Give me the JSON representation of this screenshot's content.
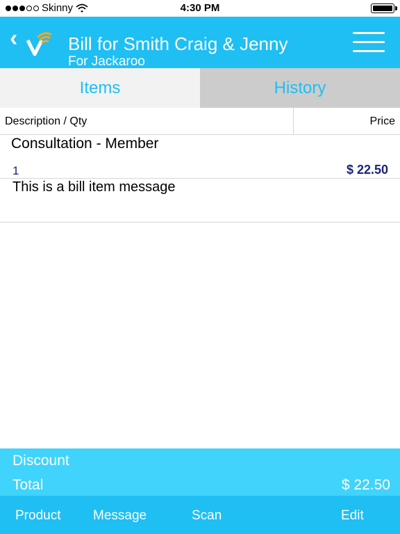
{
  "status_bar": {
    "carrier": "Skinny",
    "time": "4:30 PM",
    "signal_icon": "signal-dots-icon",
    "wifi_icon": "wifi-icon",
    "battery_icon": "battery-icon"
  },
  "header": {
    "title": "Bill for Smith Craig & Jenny",
    "subtitle": "For Jackaroo",
    "back_icon": "chevron-left-icon",
    "logo_icon": "logo-icon",
    "menu_icon": "hamburger-menu-icon",
    "background": "#1fbef3"
  },
  "tabs": [
    {
      "label": "Items",
      "active": true
    },
    {
      "label": "History",
      "active": false
    }
  ],
  "table": {
    "col_description": "Description / Qty",
    "col_price": "Price"
  },
  "items": [
    {
      "description": "Consultation - Member",
      "qty": "1",
      "price": "$ 22.50",
      "message": "This is a bill item message"
    }
  ],
  "totals": {
    "discount_label": "Discount",
    "total_label": "Total",
    "total_value": "$ 22.50",
    "background": "#40d3fb"
  },
  "toolbar": {
    "product_label": "Product",
    "message_label": "Message",
    "scan_label": "Scan",
    "edit_label": "Edit"
  }
}
